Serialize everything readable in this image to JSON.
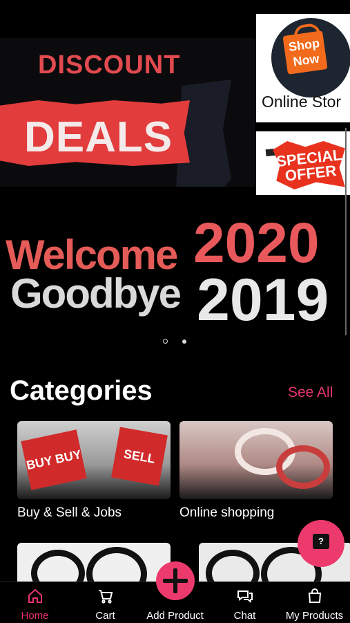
{
  "banner": {
    "main_top": "DISCOUNT",
    "main_big": "DEALS",
    "side1_badge": "Shop Now",
    "side1_caption": "Online Stor",
    "side2_caption": "SPECIAL OFFER",
    "welcome_word": "Welcome",
    "welcome_year": "2020",
    "goodbye_word": "Goodbye",
    "goodbye_year": "2019",
    "page_count": 2,
    "current_page": 1
  },
  "categories": {
    "title": "Categories",
    "see_all": "See All",
    "items": [
      {
        "label": "Buy & Sell & Jobs",
        "cube_texts": [
          "BUY BUY",
          "SELL SELL"
        ]
      },
      {
        "label": "Online shopping"
      }
    ]
  },
  "help_button": {
    "icon": "help-chat-icon",
    "glyph": "?"
  },
  "bottom_nav": {
    "items": [
      {
        "label": "Home",
        "icon": "home-icon",
        "active": true
      },
      {
        "label": "Cart",
        "icon": "cart-icon",
        "active": false
      },
      {
        "label": "Add Product",
        "icon": "plus-icon",
        "active": false
      },
      {
        "label": "Chat",
        "icon": "chat-icon",
        "active": false
      },
      {
        "label": "My Products",
        "icon": "shopping-bag-icon",
        "active": false
      }
    ]
  },
  "colors": {
    "accent": "#ec3a6d",
    "background": "#000000",
    "active_nav": "#e8356d"
  }
}
